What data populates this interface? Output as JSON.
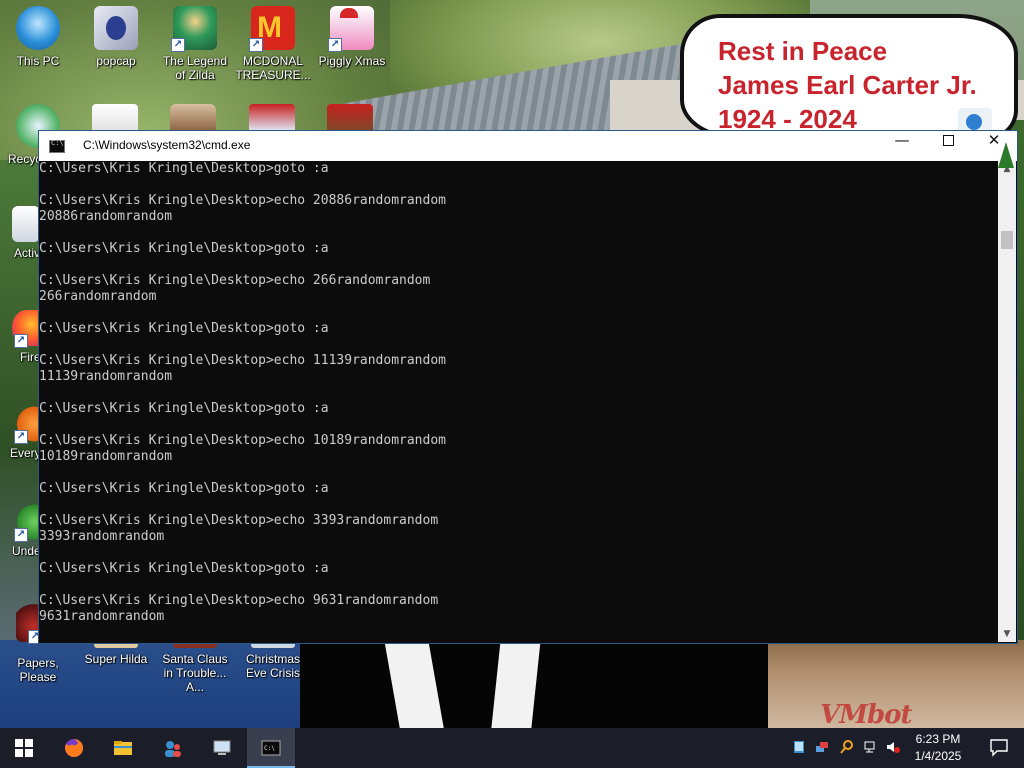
{
  "desktop": {
    "icons": [
      {
        "name": "this-pc-icon",
        "label": "This PC",
        "color": "#2a8fd8"
      },
      {
        "name": "popcap-icon",
        "label": "popcap",
        "color": "#9aa0b8"
      },
      {
        "name": "legend-of-zilda-icon",
        "label": "The Legend of Zilda",
        "color": "#2f9a5a"
      },
      {
        "name": "mcdonald-treasure-icon",
        "label": "MCDONAL TREASURE...",
        "color": "#d9261c"
      },
      {
        "name": "piggly-xmas-icon",
        "label": "Piggly Xmas",
        "color": "#f08ac0"
      },
      {
        "name": "recycle-bin-icon",
        "label": "Recyc"
      },
      {
        "name": "active-icon",
        "label": "Activ"
      },
      {
        "name": "firefox-icon",
        "label": "Fire"
      },
      {
        "name": "every-icon",
        "label": "Every"
      },
      {
        "name": "under-icon",
        "label": "Unde"
      },
      {
        "name": "papers-please-icon",
        "label": "Papers, Please"
      },
      {
        "name": "super-hilda-icon",
        "label": "Super Hilda"
      },
      {
        "name": "santa-claus-trouble-icon",
        "label": "Santa Claus in Trouble... A..."
      },
      {
        "name": "christmas-eve-crisis-icon",
        "label": "Christmas Eve Crisis"
      }
    ],
    "watermark": "VMbot"
  },
  "memorial": {
    "line1": "Rest in Peace",
    "line2": "James Earl Carter Jr.",
    "line3": "1924 - 2024"
  },
  "cmd": {
    "title": "C:\\Windows\\system32\\cmd.exe",
    "min_glyph": "—",
    "close_glyph": "✕",
    "lines": [
      "C:\\Users\\Kris Kringle\\Desktop>goto :a",
      "",
      "C:\\Users\\Kris Kringle\\Desktop>echo 20886randomrandom",
      "20886randomrandom",
      "",
      "C:\\Users\\Kris Kringle\\Desktop>goto :a",
      "",
      "C:\\Users\\Kris Kringle\\Desktop>echo 266randomrandom",
      "266randomrandom",
      "",
      "C:\\Users\\Kris Kringle\\Desktop>goto :a",
      "",
      "C:\\Users\\Kris Kringle\\Desktop>echo 11139randomrandom",
      "11139randomrandom",
      "",
      "C:\\Users\\Kris Kringle\\Desktop>goto :a",
      "",
      "C:\\Users\\Kris Kringle\\Desktop>echo 10189randomrandom",
      "10189randomrandom",
      "",
      "C:\\Users\\Kris Kringle\\Desktop>goto :a",
      "",
      "C:\\Users\\Kris Kringle\\Desktop>echo 3393randomrandom",
      "3393randomrandom",
      "",
      "C:\\Users\\Kris Kringle\\Desktop>goto :a",
      "",
      "C:\\Users\\Kris Kringle\\Desktop>echo 9631randomrandom",
      "9631randomrandom"
    ]
  },
  "taskbar": {
    "items": [
      {
        "name": "start-button",
        "icon": "windows-logo-icon"
      },
      {
        "name": "taskbar-firefox",
        "icon": "firefox-icon"
      },
      {
        "name": "taskbar-file-explorer",
        "icon": "folder-icon"
      },
      {
        "name": "taskbar-people",
        "icon": "people-icon"
      },
      {
        "name": "taskbar-computer",
        "icon": "computer-icon"
      },
      {
        "name": "taskbar-cmd",
        "icon": "cmd-icon",
        "active": true
      }
    ],
    "tray": [
      "tablet-icon",
      "network-share-icon",
      "search-magnifier-icon",
      "network-icon",
      "volume-muted-icon"
    ],
    "time": "6:23 PM",
    "date": "1/4/2025"
  }
}
